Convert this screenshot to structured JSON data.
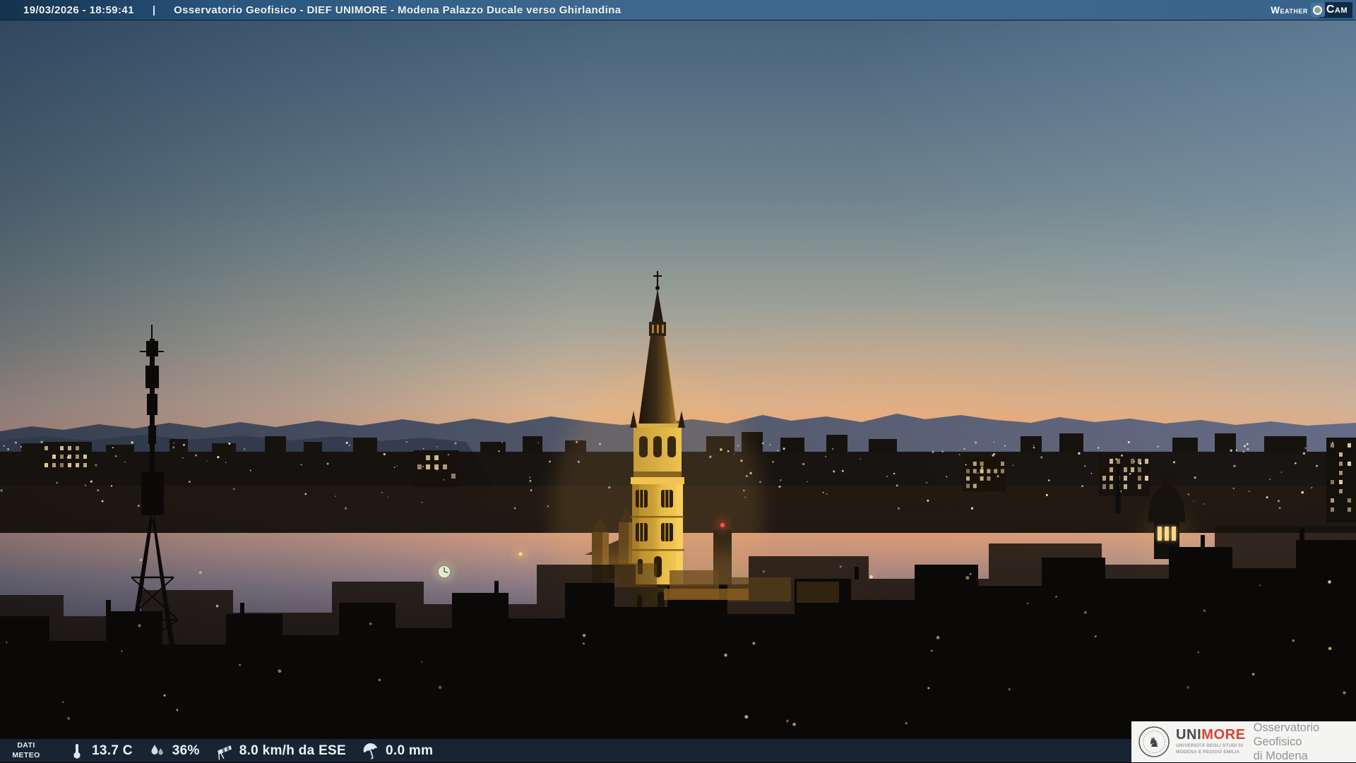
{
  "header": {
    "timestamp": "19/03/2026 - 18:59:41",
    "separator": "|",
    "title": "Osservatorio Geofisico - DIEF UNIMORE - Modena Palazzo Ducale verso Ghirlandina",
    "logo": {
      "part1": "Weather",
      "part2": "Cam"
    }
  },
  "footer": {
    "label_line1": "DATI",
    "label_line2": "METEO",
    "temperature": "13.7 C",
    "humidity": "36%",
    "wind": "8.0 km/h da ESE",
    "rain": "0.0 mm"
  },
  "branding": {
    "logo_part1": "UNI",
    "logo_part2": "MORE",
    "logo_sub_line1": "UNIVERSITÀ DEGLI STUDI DI",
    "logo_sub_line2": "MODENA E REGGIO EMILIA",
    "org_line1": "Osservatorio Geofisico",
    "org_line2": "di Modena"
  },
  "colors": {
    "topbar_left": "#14324d",
    "topbar_mid": "#3c6890",
    "topbar_right": "#38628a",
    "weathercam_chip": "#0f2b44",
    "weathercam_tile": "#48759f",
    "sky_top_left": "#3f5d79",
    "sky_top_right": "#7d95a9",
    "sunset_orange": "#f0a478",
    "mountain_dark": "#394358",
    "mountain_light": "#5d6680",
    "city_dark": "#0b0908",
    "tower_gold": "#f2c54b",
    "tower_gold_shadow": "#bd8f2c",
    "spire_dark": "#241a10",
    "glow": "#ffbe5e",
    "unimore_red": "#d6452f",
    "logo_gray": "#4a4a4a",
    "text_gray": "#949494"
  }
}
